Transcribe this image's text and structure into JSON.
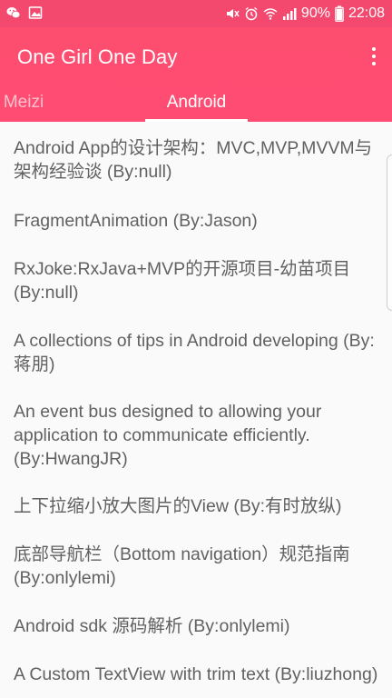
{
  "status_bar": {
    "left_icons": [
      "wechat-icon",
      "image-icon"
    ],
    "right_icons": [
      "mute-icon",
      "alarm-icon",
      "wifi-icon",
      "signal-icon",
      "battery-icon"
    ],
    "battery": "90%",
    "time": "22:08"
  },
  "app_bar": {
    "title": "One Girl One Day",
    "menu_icon": "more-vert-icon",
    "color": "#ff4e72"
  },
  "tabs": [
    {
      "label": "Meizi",
      "selected": false
    },
    {
      "label": "Android",
      "selected": true
    }
  ],
  "list": {
    "items": [
      {
        "title": "Android App的设计架构：MVC,MVP,MVVM与架构经验谈 (By:null)"
      },
      {
        "title": "FragmentAnimation (By:Jason)"
      },
      {
        "title": "RxJoke:RxJava+MVP的开源项目-幼苗项目 (By:null)"
      },
      {
        "title": "A collections of tips in Android developing (By:蒋朋)"
      },
      {
        "title": "An event bus designed to allowing your application to communicate efficiently. (By:HwangJR)"
      },
      {
        "title": "上下拉缩小放大图片的View (By:有时放纵)"
      },
      {
        "title": "底部导航栏（Bottom navigation）规范指南 (By:onlylemi)"
      },
      {
        "title": "Android sdk 源码解析 (By:onlylemi)"
      },
      {
        "title": "A Custom TextView with trim text (By:liuzhong)"
      }
    ]
  }
}
